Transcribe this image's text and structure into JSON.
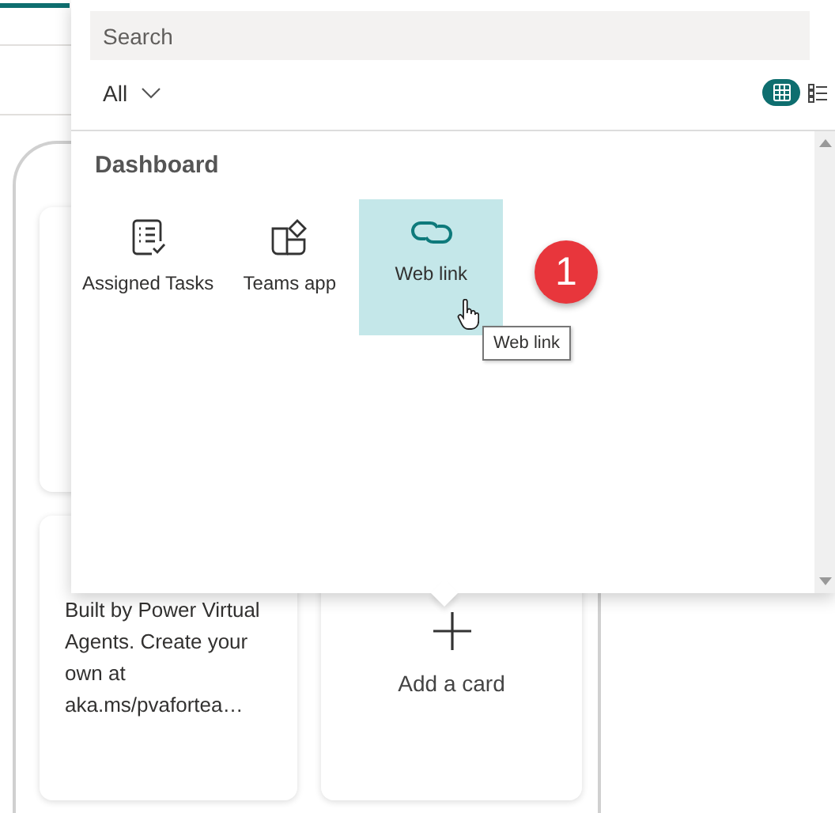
{
  "search": {
    "placeholder": "Search"
  },
  "filter": {
    "label": "All"
  },
  "view_toggle": [
    {
      "kind": "grid",
      "selected": true
    },
    {
      "kind": "list",
      "selected": false
    }
  ],
  "section": {
    "title": "Dashboard"
  },
  "items": [
    {
      "kind": "tasks",
      "label": "Assigned Tasks",
      "selected": false
    },
    {
      "kind": "apps",
      "label": "Teams app",
      "selected": false
    },
    {
      "kind": "link",
      "label": "Web link",
      "selected": true
    }
  ],
  "step_badge": "1",
  "tooltip": "Web link",
  "cards": [
    {
      "kind": "info"
    },
    {
      "kind": "text",
      "text": "Built by Power Virtual Agents. Create your own at aka.ms/pvafortea…"
    },
    {
      "kind": "add",
      "label": "Add a card"
    }
  ]
}
